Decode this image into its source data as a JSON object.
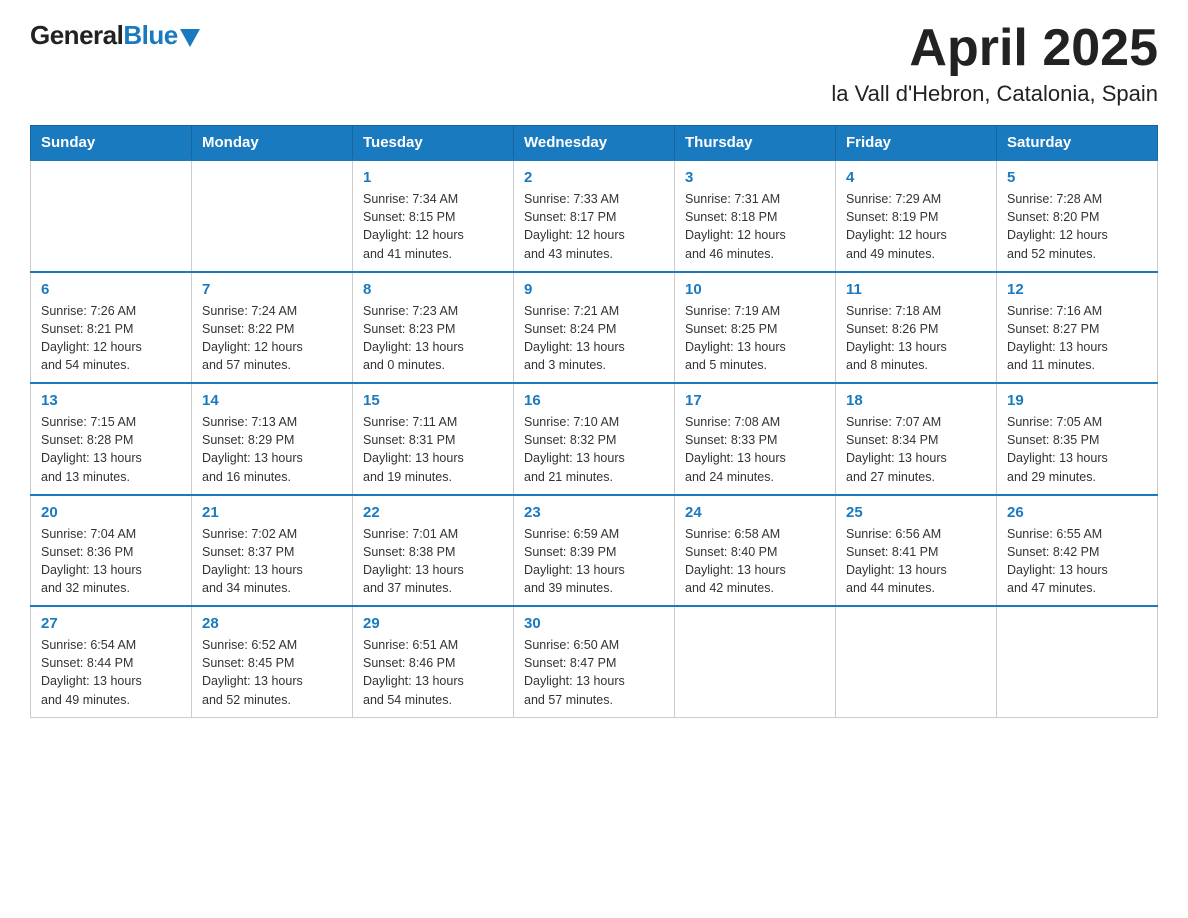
{
  "header": {
    "logo": {
      "general": "General",
      "blue": "Blue"
    },
    "title": "April 2025",
    "subtitle": "la Vall d'Hebron, Catalonia, Spain"
  },
  "days_of_week": [
    "Sunday",
    "Monday",
    "Tuesday",
    "Wednesday",
    "Thursday",
    "Friday",
    "Saturday"
  ],
  "weeks": [
    [
      {
        "day": "",
        "info": ""
      },
      {
        "day": "",
        "info": ""
      },
      {
        "day": "1",
        "info": "Sunrise: 7:34 AM\nSunset: 8:15 PM\nDaylight: 12 hours\nand 41 minutes."
      },
      {
        "day": "2",
        "info": "Sunrise: 7:33 AM\nSunset: 8:17 PM\nDaylight: 12 hours\nand 43 minutes."
      },
      {
        "day": "3",
        "info": "Sunrise: 7:31 AM\nSunset: 8:18 PM\nDaylight: 12 hours\nand 46 minutes."
      },
      {
        "day": "4",
        "info": "Sunrise: 7:29 AM\nSunset: 8:19 PM\nDaylight: 12 hours\nand 49 minutes."
      },
      {
        "day": "5",
        "info": "Sunrise: 7:28 AM\nSunset: 8:20 PM\nDaylight: 12 hours\nand 52 minutes."
      }
    ],
    [
      {
        "day": "6",
        "info": "Sunrise: 7:26 AM\nSunset: 8:21 PM\nDaylight: 12 hours\nand 54 minutes."
      },
      {
        "day": "7",
        "info": "Sunrise: 7:24 AM\nSunset: 8:22 PM\nDaylight: 12 hours\nand 57 minutes."
      },
      {
        "day": "8",
        "info": "Sunrise: 7:23 AM\nSunset: 8:23 PM\nDaylight: 13 hours\nand 0 minutes."
      },
      {
        "day": "9",
        "info": "Sunrise: 7:21 AM\nSunset: 8:24 PM\nDaylight: 13 hours\nand 3 minutes."
      },
      {
        "day": "10",
        "info": "Sunrise: 7:19 AM\nSunset: 8:25 PM\nDaylight: 13 hours\nand 5 minutes."
      },
      {
        "day": "11",
        "info": "Sunrise: 7:18 AM\nSunset: 8:26 PM\nDaylight: 13 hours\nand 8 minutes."
      },
      {
        "day": "12",
        "info": "Sunrise: 7:16 AM\nSunset: 8:27 PM\nDaylight: 13 hours\nand 11 minutes."
      }
    ],
    [
      {
        "day": "13",
        "info": "Sunrise: 7:15 AM\nSunset: 8:28 PM\nDaylight: 13 hours\nand 13 minutes."
      },
      {
        "day": "14",
        "info": "Sunrise: 7:13 AM\nSunset: 8:29 PM\nDaylight: 13 hours\nand 16 minutes."
      },
      {
        "day": "15",
        "info": "Sunrise: 7:11 AM\nSunset: 8:31 PM\nDaylight: 13 hours\nand 19 minutes."
      },
      {
        "day": "16",
        "info": "Sunrise: 7:10 AM\nSunset: 8:32 PM\nDaylight: 13 hours\nand 21 minutes."
      },
      {
        "day": "17",
        "info": "Sunrise: 7:08 AM\nSunset: 8:33 PM\nDaylight: 13 hours\nand 24 minutes."
      },
      {
        "day": "18",
        "info": "Sunrise: 7:07 AM\nSunset: 8:34 PM\nDaylight: 13 hours\nand 27 minutes."
      },
      {
        "day": "19",
        "info": "Sunrise: 7:05 AM\nSunset: 8:35 PM\nDaylight: 13 hours\nand 29 minutes."
      }
    ],
    [
      {
        "day": "20",
        "info": "Sunrise: 7:04 AM\nSunset: 8:36 PM\nDaylight: 13 hours\nand 32 minutes."
      },
      {
        "day": "21",
        "info": "Sunrise: 7:02 AM\nSunset: 8:37 PM\nDaylight: 13 hours\nand 34 minutes."
      },
      {
        "day": "22",
        "info": "Sunrise: 7:01 AM\nSunset: 8:38 PM\nDaylight: 13 hours\nand 37 minutes."
      },
      {
        "day": "23",
        "info": "Sunrise: 6:59 AM\nSunset: 8:39 PM\nDaylight: 13 hours\nand 39 minutes."
      },
      {
        "day": "24",
        "info": "Sunrise: 6:58 AM\nSunset: 8:40 PM\nDaylight: 13 hours\nand 42 minutes."
      },
      {
        "day": "25",
        "info": "Sunrise: 6:56 AM\nSunset: 8:41 PM\nDaylight: 13 hours\nand 44 minutes."
      },
      {
        "day": "26",
        "info": "Sunrise: 6:55 AM\nSunset: 8:42 PM\nDaylight: 13 hours\nand 47 minutes."
      }
    ],
    [
      {
        "day": "27",
        "info": "Sunrise: 6:54 AM\nSunset: 8:44 PM\nDaylight: 13 hours\nand 49 minutes."
      },
      {
        "day": "28",
        "info": "Sunrise: 6:52 AM\nSunset: 8:45 PM\nDaylight: 13 hours\nand 52 minutes."
      },
      {
        "day": "29",
        "info": "Sunrise: 6:51 AM\nSunset: 8:46 PM\nDaylight: 13 hours\nand 54 minutes."
      },
      {
        "day": "30",
        "info": "Sunrise: 6:50 AM\nSunset: 8:47 PM\nDaylight: 13 hours\nand 57 minutes."
      },
      {
        "day": "",
        "info": ""
      },
      {
        "day": "",
        "info": ""
      },
      {
        "day": "",
        "info": ""
      }
    ]
  ]
}
